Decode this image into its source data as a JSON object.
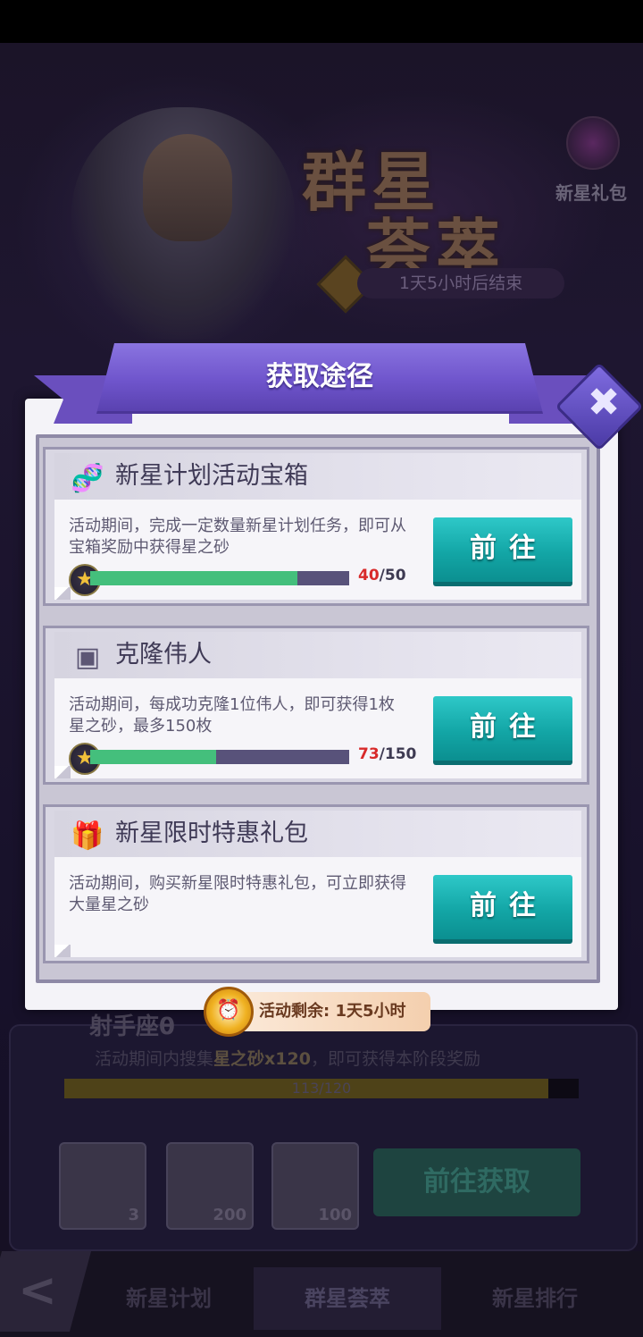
{
  "background": {
    "event_title_line1": "群星",
    "event_title_line2": "荟萃",
    "event_timer": "1天5小时后结束",
    "gift_label": "新星礼包",
    "stage": {
      "name": "射手座θ",
      "desc_prefix": "活动期间内搜集",
      "desc_item": "星之砂x120",
      "desc_suffix": "，即可获得本阶段奖励",
      "progress_text": "113/120",
      "progress_current": 113,
      "progress_max": 120,
      "rewards": [
        {
          "icon": "card-pack-icon",
          "qty": "3"
        },
        {
          "icon": "canister-icon",
          "qty": "200"
        },
        {
          "icon": "ring-icon",
          "qty": "100"
        }
      ],
      "action_button": "前往获取"
    },
    "tabs": [
      "新星计划",
      "群星荟萃",
      "新星排行"
    ],
    "active_tab": "群星荟萃"
  },
  "modal": {
    "title": "获取途径",
    "close_icon": "close-icon",
    "cards": [
      {
        "icon": "dna-icon",
        "title": "新星计划活动宝箱",
        "description": "活动期间，完成一定数量新星计划任务，即可从宝箱奖励中获得星之砂",
        "progress_current": "40",
        "progress_max": "/50",
        "progress_fraction": 0.8,
        "button": "前往"
      },
      {
        "icon": "clone-chest-icon",
        "title": "克隆伟人",
        "description": "活动期间，每成功克隆1位伟人，即可获得1枚星之砂，最多150枚",
        "progress_current": "73",
        "progress_max": "/150",
        "progress_fraction": 0.4867,
        "button": "前往"
      },
      {
        "icon": "gift-icon",
        "title": "新星限时特惠礼包",
        "description": "活动期间，购买新星限时特惠礼包，可立即获得大量星之砂",
        "button": "前往"
      }
    ],
    "remaining_label": "活动剩余: 1天5小时"
  },
  "colors": {
    "ribbon": "#6f55cc",
    "button": "#13a6a6",
    "progress_fill": "#44bf7c",
    "progress_count_current": "#d82a2a"
  }
}
